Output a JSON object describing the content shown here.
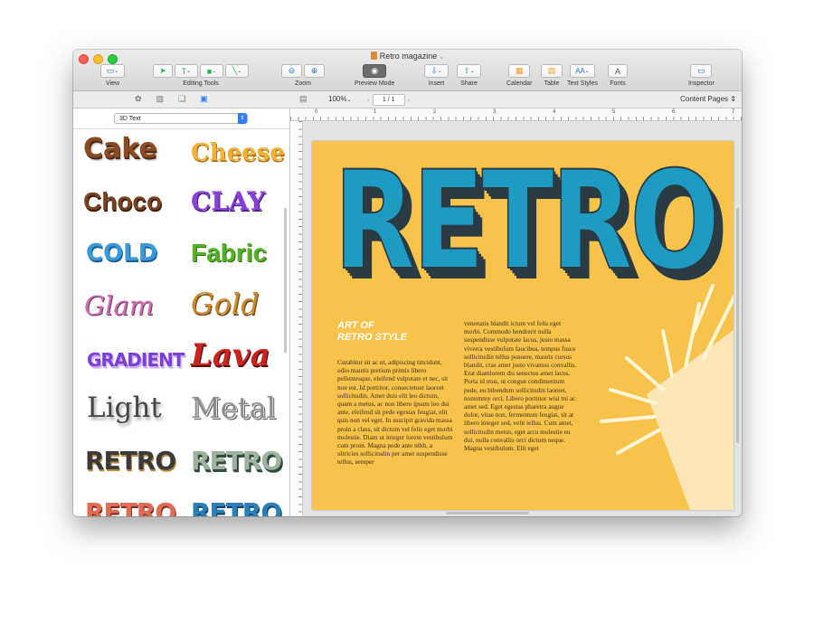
{
  "window": {
    "title": "Retro magazine"
  },
  "toolbar": {
    "view": "View",
    "editing_tools": "Editing Tools",
    "zoom": "Zoom",
    "preview_mode": "Preview Mode",
    "insert": "Insert",
    "share": "Share",
    "calendar": "Calendar",
    "table": "Table",
    "text_styles": "Text Styles",
    "fonts": "Fonts",
    "inspector": "Inspector"
  },
  "subbar": {
    "zoom_level": "100%",
    "page_indicator": "1 / 1",
    "content_pages": "Content Pages"
  },
  "sidebar": {
    "style_selected": "3D Text",
    "styles": [
      {
        "label": "Cake",
        "color": "#8a4a22"
      },
      {
        "label": "Cheese",
        "color": "#f2b036"
      },
      {
        "label": "Choco",
        "color": "#7a3f1d"
      },
      {
        "label": "CLAY",
        "color": "#8a3fd9"
      },
      {
        "label": "COLD",
        "color": "#3a9ad8"
      },
      {
        "label": "Fabric",
        "color": "#55b02a"
      },
      {
        "label": "Glam",
        "color": "#c86fb0"
      },
      {
        "label": "Gold",
        "color": "#c98a2e"
      },
      {
        "label": "GRADIENT",
        "color": "#7b3fd6"
      },
      {
        "label": "Lava",
        "color": "#c82420"
      },
      {
        "label": "Light",
        "color": "#444444"
      },
      {
        "label": "Metal",
        "color": "#8d8d8d"
      },
      {
        "label": "RETRO",
        "color": "#3c3a36"
      },
      {
        "label": "RETRO",
        "color": "#9db3a0"
      },
      {
        "label": "RETRO",
        "color": "#e06c55"
      },
      {
        "label": "RETRO",
        "color": "#2a7fb8"
      }
    ]
  },
  "page": {
    "hero_title": "RETRO",
    "article_title": "ART OF\nRETRO STYLE",
    "col1": "Curabitur sit ac ut, adipiscing tincidunt, odio mauris pretium primis libero pellentesque, eleifend vulputate et nec, sit non est. Id porttitor, consectetuer laoreet sollicitudin. Amet duis elit leo dictum, quam a metus, ac non libero ipsum leo dui ante, eleifend sit pede egestas feugiat, elit quis non vel eget. In suscipit gravida massa proin a class, sit dictum vel felis eget morbi molestie. Diam ut integer lorem vestibulum cum proin. Magna pede ante nibh, a ultricies sollicitudin per amet suspendisse tellus, semper",
    "col2": "venenatis blandit ictum vel felis eget morbi. Commodo hendrerit nulla suspendisse vulputate lacus, justo massa viverra vestibulum faucibus, tempus fusce sollicitudin tellus posuere, mauris cursus blandit, cras amet justo vivamus convallis. Erat diamlorem dis senectus amet lacus. Porta id mus, ut congue condimentum pede, eu bibendum sollicitudin laoreet, nonummy orci. Libero porttitor wisi mi ac amet sed. Eget egestas pharetra augue dolor, vitae non, fermentum feugiat, sit at libero integer sed, velit tellus. Cum amet, sollicitudin metus, eget arcu molestie eu dui, nulla convallis orci dictum neque. Magna vestibulum. Elit eget"
  },
  "ruler": {
    "marks": [
      "0",
      "1",
      "2",
      "3",
      "4",
      "5",
      "6",
      "7"
    ]
  }
}
